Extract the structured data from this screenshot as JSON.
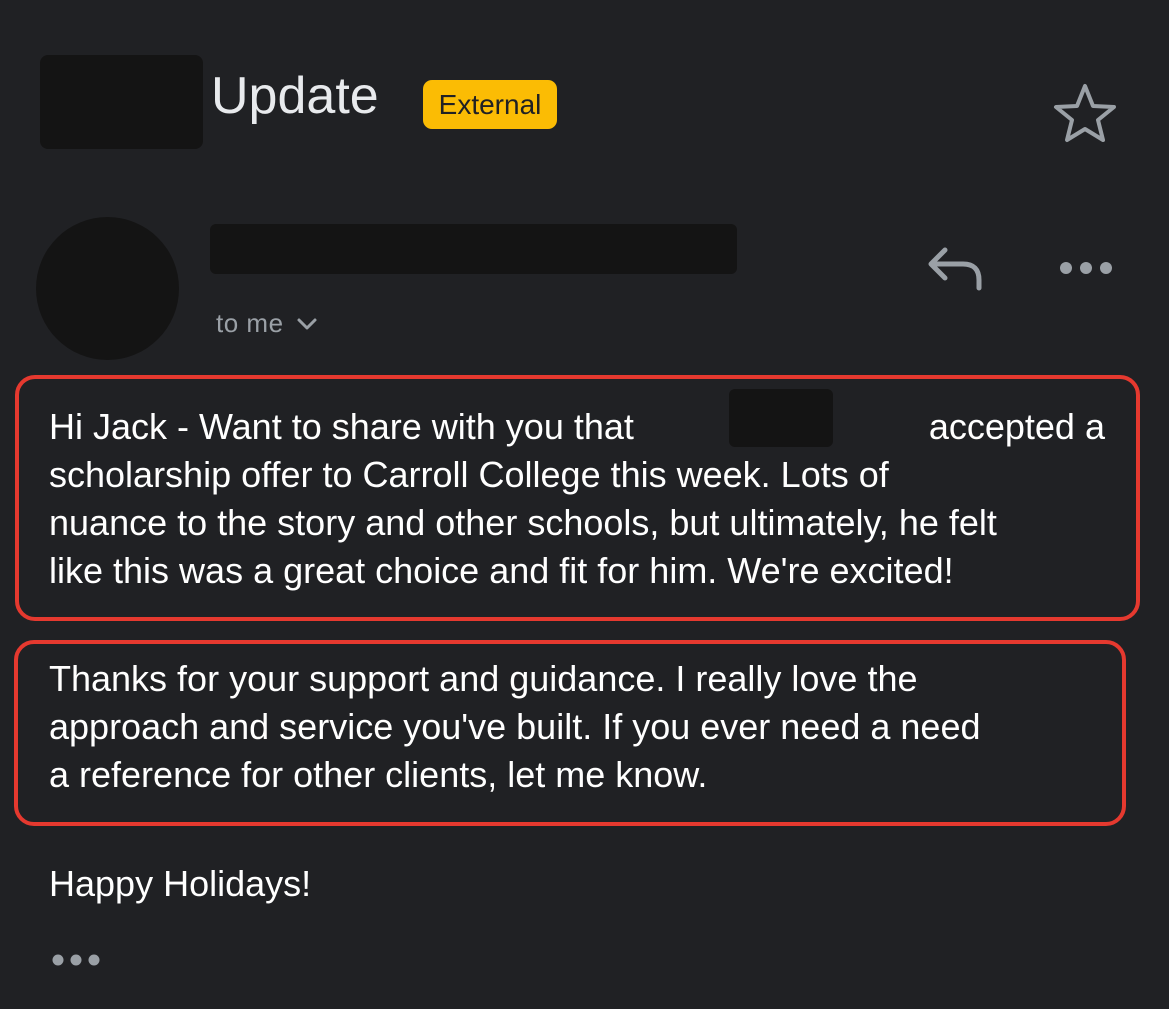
{
  "header": {
    "subject": "Update",
    "badge": "External",
    "star_icon": "star-outline-icon"
  },
  "message": {
    "recipient_label": "to me",
    "recipient_chevron_icon": "chevron-down-icon",
    "reply_icon": "reply-icon",
    "more_icon": "more-horiz-icon"
  },
  "body": {
    "paragraph_1": {
      "line_1_before": "Hi Jack - Want to share with you that",
      "line_1_after": "accepted a",
      "line_2": "scholarship offer to Carroll College this week. Lots of",
      "line_3": "nuance to the story and other schools, but ultimately, he felt",
      "line_4": "like this was a great choice and fit for him. We're excited!"
    },
    "paragraph_2": {
      "line_1": "Thanks for your support and guidance. I really love the",
      "line_2": "approach and service you've built. If you ever need a need",
      "line_3": "a reference for other clients, let me know."
    },
    "closing": "Happy Holidays!",
    "trimmed_icon": "more-horiz-icon"
  },
  "colors": {
    "background": "#202124",
    "badge": "#fbbc04",
    "highlight_border": "#e5392f",
    "redaction": "#141414"
  }
}
